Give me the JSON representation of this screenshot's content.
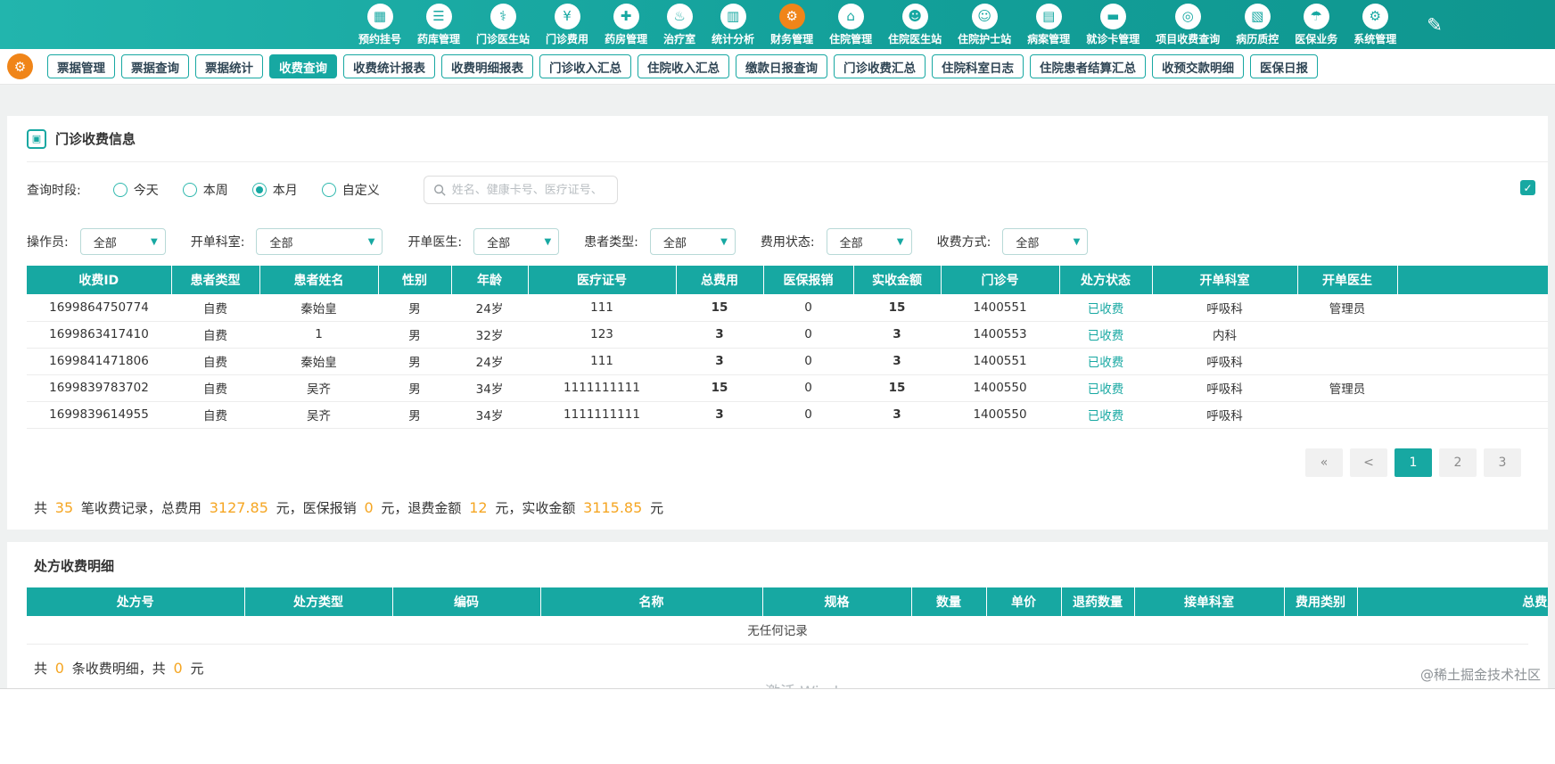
{
  "colors": {
    "teal": "#17a8a2",
    "orange_accent": "#f08519",
    "number_orange": "#f5a623"
  },
  "top_nav": {
    "edit_icon": "✎",
    "items": [
      {
        "label": "预约挂号",
        "glyph": "▦"
      },
      {
        "label": "药库管理",
        "glyph": "☰"
      },
      {
        "label": "门诊医生站",
        "glyph": "⚕"
      },
      {
        "label": "门诊费用",
        "glyph": "¥"
      },
      {
        "label": "药房管理",
        "glyph": "✚"
      },
      {
        "label": "治疗室",
        "glyph": "♨"
      },
      {
        "label": "统计分析",
        "glyph": "▥"
      },
      {
        "label": "财务管理",
        "glyph": "⚙",
        "active": true
      },
      {
        "label": "住院管理",
        "glyph": "⌂"
      },
      {
        "label": "住院医生站",
        "glyph": "☻"
      },
      {
        "label": "住院护士站",
        "glyph": "☺"
      },
      {
        "label": "病案管理",
        "glyph": "▤"
      },
      {
        "label": "就诊卡管理",
        "glyph": "▬"
      },
      {
        "label": "项目收费查询",
        "glyph": "◎"
      },
      {
        "label": "病历质控",
        "glyph": "▧"
      },
      {
        "label": "医保业务",
        "glyph": "☂"
      },
      {
        "label": "系统管理",
        "glyph": "⚙"
      }
    ]
  },
  "toolbar": {
    "gear_glyph": "⚙",
    "buttons": [
      {
        "label": "票据管理"
      },
      {
        "label": "票据查询"
      },
      {
        "label": "票据统计"
      },
      {
        "label": "收费查询",
        "active": true
      },
      {
        "label": "收费统计报表"
      },
      {
        "label": "收费明细报表"
      },
      {
        "label": "门诊收入汇总"
      },
      {
        "label": "住院收入汇总"
      },
      {
        "label": "缴款日报查询"
      },
      {
        "label": "门诊收费汇总"
      },
      {
        "label": "住院科室日志"
      },
      {
        "label": "住院患者结算汇总"
      },
      {
        "label": "收预交款明细"
      },
      {
        "label": "医保日报"
      }
    ]
  },
  "panel": {
    "icon_glyph": "▣",
    "title": "门诊收费信息",
    "time_filter_label": "查询时段:",
    "time_options": [
      {
        "label": "今天"
      },
      {
        "label": "本周"
      },
      {
        "label": "本月",
        "checked": true
      },
      {
        "label": "自定义"
      }
    ],
    "search_placeholder": "姓名、健康卡号、医疗证号、",
    "checkbox_glyph": "✓",
    "filters": [
      {
        "label": "操作员:",
        "value": "全部"
      },
      {
        "label": "开单科室:",
        "value": "全部",
        "wide": true
      },
      {
        "label": "开单医生:",
        "value": "全部"
      },
      {
        "label": "患者类型:",
        "value": "全部"
      },
      {
        "label": "费用状态:",
        "value": "全部"
      },
      {
        "label": "收费方式:",
        "value": "全部"
      }
    ]
  },
  "main_table": {
    "headers": [
      "收费ID",
      "患者类型",
      "患者姓名",
      "性别",
      "年龄",
      "医疗证号",
      "总费用",
      "医保报销",
      "实收金额",
      "门诊号",
      "处方状态",
      "开单科室",
      "开单医生",
      ""
    ],
    "rows": [
      {
        "id": "1699864750774",
        "patient_type": "自费",
        "patient_name": "秦始皇",
        "sex": "男",
        "age": "24岁",
        "cert_no": "111",
        "total_fee": "15",
        "insurance": "0",
        "received": "15",
        "clinic_no": "1400551",
        "status": "已收费",
        "dept": "呼吸科",
        "doctor": "管理员"
      },
      {
        "id": "1699863417410",
        "patient_type": "自费",
        "patient_name": "1",
        "sex": "男",
        "age": "32岁",
        "cert_no": "123",
        "total_fee": "3",
        "insurance": "0",
        "received": "3",
        "clinic_no": "1400553",
        "status": "已收费",
        "dept": "内科",
        "doctor": ""
      },
      {
        "id": "1699841471806",
        "patient_type": "自费",
        "patient_name": "秦始皇",
        "sex": "男",
        "age": "24岁",
        "cert_no": "111",
        "total_fee": "3",
        "insurance": "0",
        "received": "3",
        "clinic_no": "1400551",
        "status": "已收费",
        "dept": "呼吸科",
        "doctor": ""
      },
      {
        "id": "1699839783702",
        "patient_type": "自费",
        "patient_name": "吴齐",
        "sex": "男",
        "age": "34岁",
        "cert_no": "1111111111",
        "total_fee": "15",
        "insurance": "0",
        "received": "15",
        "clinic_no": "1400550",
        "status": "已收费",
        "dept": "呼吸科",
        "doctor": "管理员"
      },
      {
        "id": "1699839614955",
        "patient_type": "自费",
        "patient_name": "吴齐",
        "sex": "男",
        "age": "34岁",
        "cert_no": "1111111111",
        "total_fee": "3",
        "insurance": "0",
        "received": "3",
        "clinic_no": "1400550",
        "status": "已收费",
        "dept": "呼吸科",
        "doctor": ""
      }
    ]
  },
  "pagination": {
    "items": [
      {
        "label": "«"
      },
      {
        "label": "<"
      },
      {
        "label": "1",
        "active": true
      },
      {
        "label": "2"
      },
      {
        "label": "3"
      }
    ]
  },
  "summary": {
    "segments": [
      {
        "text": "共 "
      },
      {
        "text": "35",
        "highlight": true
      },
      {
        "text": " 笔收费记录，总费用 "
      },
      {
        "text": "3127.85",
        "highlight": true
      },
      {
        "text": " 元，医保报销 "
      },
      {
        "text": "0",
        "highlight": true
      },
      {
        "text": " 元，退费金额 "
      },
      {
        "text": "12",
        "highlight": true
      },
      {
        "text": " 元，实收金额 "
      },
      {
        "text": "3115.85",
        "highlight": true
      },
      {
        "text": " 元"
      }
    ]
  },
  "detail_panel": {
    "title": "处方收费明细",
    "headers": [
      "处方号",
      "处方类型",
      "编码",
      "名称",
      "规格",
      "数量",
      "单价",
      "退药数量",
      "接单科室",
      "费用类别",
      "总费用"
    ],
    "empty_text": "无任何记录",
    "summary_segments": [
      {
        "text": "共 "
      },
      {
        "text": "0",
        "highlight": true
      },
      {
        "text": " 条收费明细，共 "
      },
      {
        "text": "0",
        "highlight": true
      },
      {
        "text": " 元"
      }
    ]
  },
  "watermarks": {
    "community": "@稀土掘金技术社区",
    "activate": "激活 Windows"
  }
}
